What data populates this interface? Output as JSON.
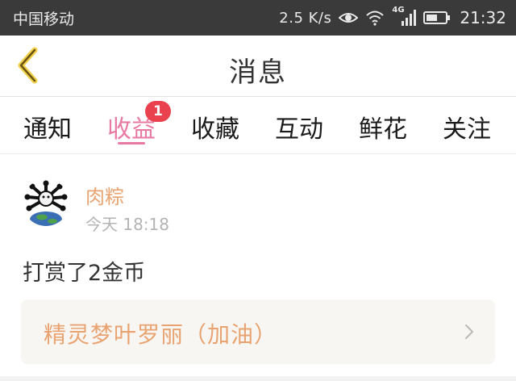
{
  "status_bar": {
    "carrier": "中国移动",
    "net_speed": "2.5 K/s",
    "network_type": "4G",
    "time": "21:32",
    "icons": [
      "eye-icon",
      "wifi-icon",
      "signal-icon",
      "battery-icon"
    ]
  },
  "header": {
    "title": "消息",
    "back_icon": "chevron-left-icon",
    "accent_color": "#e8c23a"
  },
  "tabs": [
    {
      "label": "通知",
      "active": false
    },
    {
      "label": "收益",
      "active": true,
      "badge": "1"
    },
    {
      "label": "收藏",
      "active": false
    },
    {
      "label": "互动",
      "active": false
    },
    {
      "label": "鲜花",
      "active": false
    },
    {
      "label": "关注",
      "active": false
    }
  ],
  "message": {
    "username": "肉粽",
    "time": "今天 18:18",
    "text": "打赏了2金币",
    "link_label": "精灵梦叶罗丽（加油）",
    "link_icon": "chevron-right-icon"
  },
  "colors": {
    "active_tab": "#e879a3",
    "badge": "#e9424e",
    "username": "#e8a370",
    "status_bar": "#3a3a3a"
  }
}
